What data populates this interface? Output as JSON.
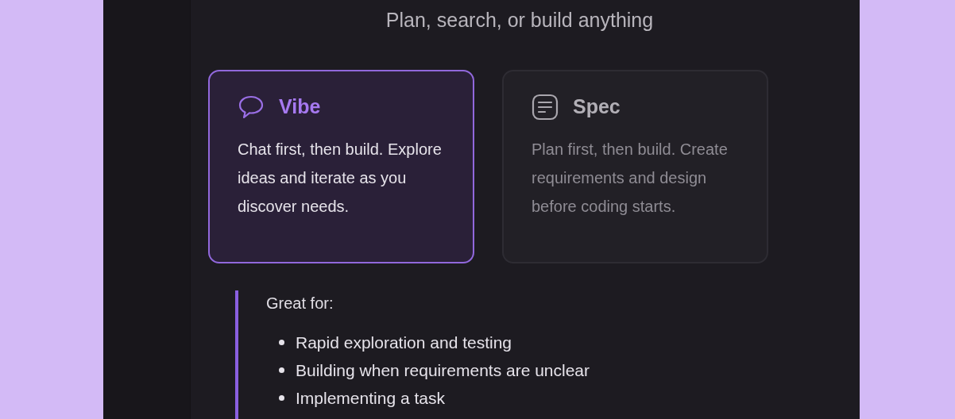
{
  "subtitle": "Plan, search, or build anything",
  "modes": [
    {
      "kind": "chat",
      "title": "Vibe",
      "description": "Chat first, then build. Explore ideas and iterate as you discover needs.",
      "selected": true
    },
    {
      "kind": "spec",
      "title": "Spec",
      "description": "Plan first, then build. Create requirements and design before coding starts.",
      "selected": false
    }
  ],
  "details": {
    "heading": "Great for:",
    "items": [
      "Rapid exploration and testing",
      "Building when requirements are unclear",
      "Implementing a task"
    ]
  }
}
